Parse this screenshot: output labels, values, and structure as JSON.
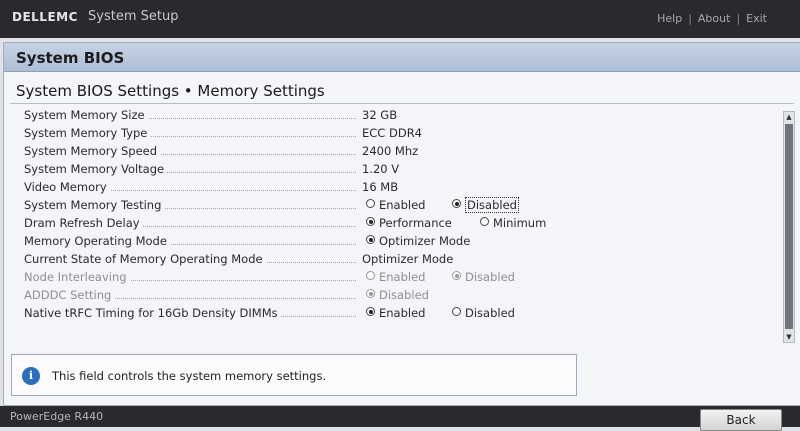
{
  "header": {
    "logo": "DELLEMC",
    "app_title": "System Setup",
    "links": [
      "Help",
      "About",
      "Exit"
    ],
    "separator": "|"
  },
  "panel": {
    "title": "System BIOS",
    "section_title": "System BIOS Settings • Memory Settings"
  },
  "settings": [
    {
      "label": "System Memory Size",
      "value": "32 GB"
    },
    {
      "label": "System Memory Type",
      "value": "ECC DDR4"
    },
    {
      "label": "System Memory Speed",
      "value": "2400 Mhz"
    },
    {
      "label": "System Memory Voltage",
      "value": "1.20 V"
    },
    {
      "label": "Video Memory",
      "value": "16 MB"
    },
    {
      "label": "System Memory Testing",
      "options": [
        "Enabled",
        "Disabled"
      ],
      "selected": "Disabled"
    },
    {
      "label": "Dram Refresh Delay",
      "options": [
        "Performance",
        "Minimum"
      ],
      "selected": "Performance"
    },
    {
      "label": "Memory Operating Mode",
      "options": [
        "Optimizer Mode"
      ],
      "selected": "Optimizer Mode"
    },
    {
      "label": "Current State of Memory Operating Mode",
      "value": "Optimizer Mode"
    },
    {
      "label": "Node Interleaving",
      "options": [
        "Enabled",
        "Disabled"
      ],
      "selected": "Disabled",
      "disabled": true
    },
    {
      "label": "ADDDC Setting",
      "options": [
        "Disabled"
      ],
      "selected": "Disabled",
      "disabled": true
    },
    {
      "label": "Native tRFC Timing for 16Gb Density DIMMs",
      "options": [
        "Enabled",
        "Disabled"
      ],
      "selected": "Enabled"
    }
  ],
  "help": {
    "icon": "info-icon",
    "text": "This field controls the system memory settings."
  },
  "footer": {
    "model": "PowerEdge R440",
    "back_label": "Back"
  },
  "colors": {
    "header_bg": "#2a2a2e",
    "title_bar": "#b7c6dc",
    "info_icon": "#2a6ebd"
  }
}
